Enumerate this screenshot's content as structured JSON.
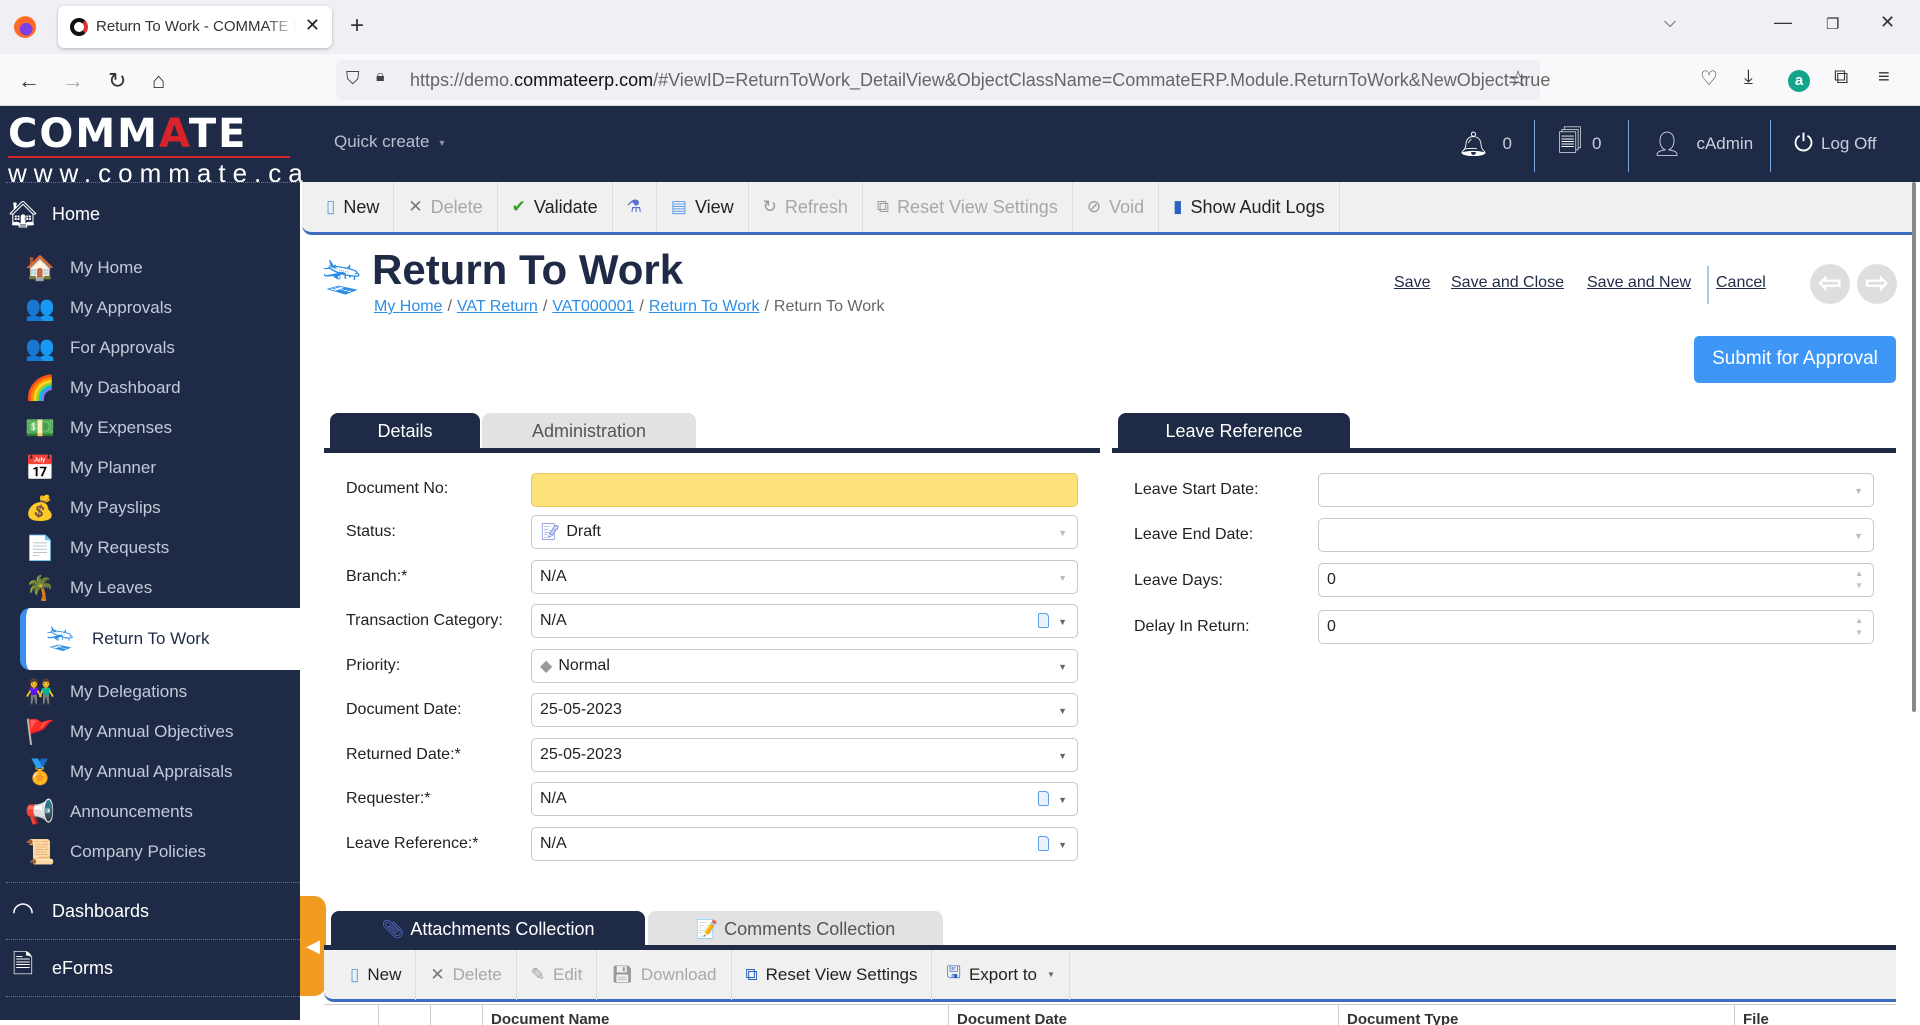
{
  "browser": {
    "tab_title": "Return To Work - COMMATE ERP",
    "url_prefix": "https://demo.",
    "url_domain": "commateerp.com",
    "url_suffix": "/#ViewID=ReturnToWork_DetailView&ObjectClassName=CommateERP.Module.ReturnToWork&NewObject=true"
  },
  "header": {
    "logo_main_1": "COMM",
    "logo_main_a": "A",
    "logo_main_2": "TE",
    "logo_sub": "www.commate.ca",
    "quick_create": "Quick create",
    "notifications_count": "0",
    "documents_count": "0",
    "user": "cAdmin",
    "logoff": "Log Off"
  },
  "sidebar": {
    "home_group": "Home",
    "items": [
      {
        "label": "My Home",
        "icon": "house-icon"
      },
      {
        "label": "My Approvals",
        "icon": "approvals-icon"
      },
      {
        "label": "For Approvals",
        "icon": "approvals-icon"
      },
      {
        "label": "My Dashboard",
        "icon": "gauge-icon"
      },
      {
        "label": "My Expenses",
        "icon": "money-icon"
      },
      {
        "label": "My Planner",
        "icon": "calendar-icon"
      },
      {
        "label": "My Payslips",
        "icon": "payslip-icon"
      },
      {
        "label": "My Requests",
        "icon": "request-icon"
      },
      {
        "label": "My Leaves",
        "icon": "palm-tree-icon"
      },
      {
        "label": "Return To Work",
        "icon": "plane-landing-icon",
        "active": true
      },
      {
        "label": "My Delegations",
        "icon": "people-icon"
      },
      {
        "label": "My Annual Objectives",
        "icon": "target-flag-icon"
      },
      {
        "label": "My Annual Appraisals",
        "icon": "medal-icon"
      },
      {
        "label": "Announcements",
        "icon": "megaphone-icon"
      },
      {
        "label": "Company Policies",
        "icon": "scroll-icon"
      }
    ],
    "groups": [
      {
        "label": "Dashboards",
        "icon": "speedometer-icon"
      },
      {
        "label": "eForms",
        "icon": "document-icon"
      }
    ]
  },
  "toolbar": {
    "new": "New",
    "delete": "Delete",
    "validate": "Validate",
    "view": "View",
    "refresh": "Refresh",
    "reset_view": "Reset View Settings",
    "void": "Void",
    "audit": "Show Audit Logs"
  },
  "page": {
    "title": "Return To Work",
    "breadcrumb": [
      "My Home",
      "VAT Return",
      "VAT000001",
      "Return To Work",
      "Return To Work"
    ],
    "actions": {
      "save": "Save",
      "save_close": "Save and Close",
      "save_new": "Save and New",
      "cancel": "Cancel"
    },
    "submit": "Submit for Approval"
  },
  "tabs": {
    "details": "Details",
    "administration": "Administration",
    "leave_reference": "Leave Reference"
  },
  "form": {
    "document_no": {
      "label": "Document No:",
      "value": ""
    },
    "status": {
      "label": "Status:",
      "value": "Draft"
    },
    "branch": {
      "label": "Branch:*",
      "value": "N/A"
    },
    "transaction_category": {
      "label": "Transaction Category:",
      "value": "N/A"
    },
    "priority": {
      "label": "Priority:",
      "value": "Normal"
    },
    "document_date": {
      "label": "Document Date:",
      "value": "25-05-2023"
    },
    "returned_date": {
      "label": "Returned Date:*",
      "value": "25-05-2023"
    },
    "requester": {
      "label": "Requester:*",
      "value": "N/A"
    },
    "leave_reference": {
      "label": "Leave Reference:*",
      "value": "N/A"
    }
  },
  "leave": {
    "start_date": {
      "label": "Leave Start Date:",
      "value": ""
    },
    "end_date": {
      "label": "Leave End Date:",
      "value": ""
    },
    "days": {
      "label": "Leave Days:",
      "value": "0"
    },
    "delay": {
      "label": "Delay In Return:",
      "value": "0"
    }
  },
  "collections": {
    "attachments_tab": "Attachments Collection",
    "comments_tab": "Comments Collection",
    "toolbar": {
      "new": "New",
      "delete": "Delete",
      "edit": "Edit",
      "download": "Download",
      "reset_view": "Reset View Settings",
      "export": "Export to"
    },
    "columns": [
      "Document Name",
      "Document Date",
      "Document Type",
      "File"
    ]
  }
}
